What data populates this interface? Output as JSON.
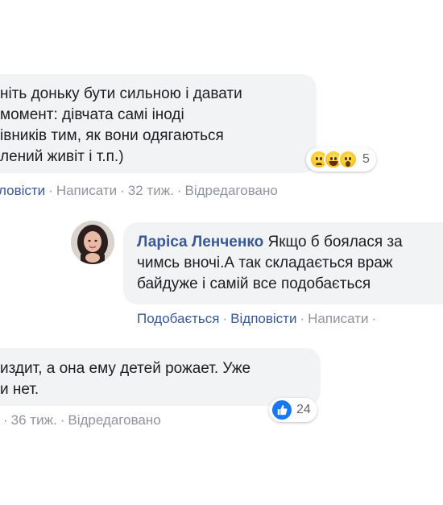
{
  "comment1": {
    "lines": [
      "ніть доньку бути сильною і давати",
      "момент: дівчата самі іноді",
      "івників тим, як вони одягаються",
      "лений живіт і т.п.)"
    ],
    "reactions": {
      "icons": [
        "sad-face-icon",
        "haha-face-icon",
        "wow-face-icon"
      ],
      "count": "5"
    },
    "actions": {
      "reply": "ловісти",
      "write": "Написати",
      "time": "32 тиж.",
      "edited": "Відредаговано"
    }
  },
  "reply": {
    "author": "Ларіса Ленченко",
    "lines": [
      "Якщо б боялася за",
      "чимсь вночі.А так складається враж",
      "байдуже і самій все подобається"
    ],
    "actions": {
      "like": "Подобається",
      "reply": "Відповісти",
      "write": "Написати"
    }
  },
  "comment2": {
    "lines": [
      "издит, а она ему детей рожает. Уже",
      "и нет."
    ],
    "reactions": {
      "icons": [
        "like-icon"
      ],
      "count": "24"
    },
    "actions": {
      "time": "36 тиж.",
      "edited": "Відредаговано"
    }
  },
  "colors": {
    "link": "#385898",
    "muted": "#90949c",
    "bubble": "#f2f3f5",
    "like": "#1877f2"
  }
}
